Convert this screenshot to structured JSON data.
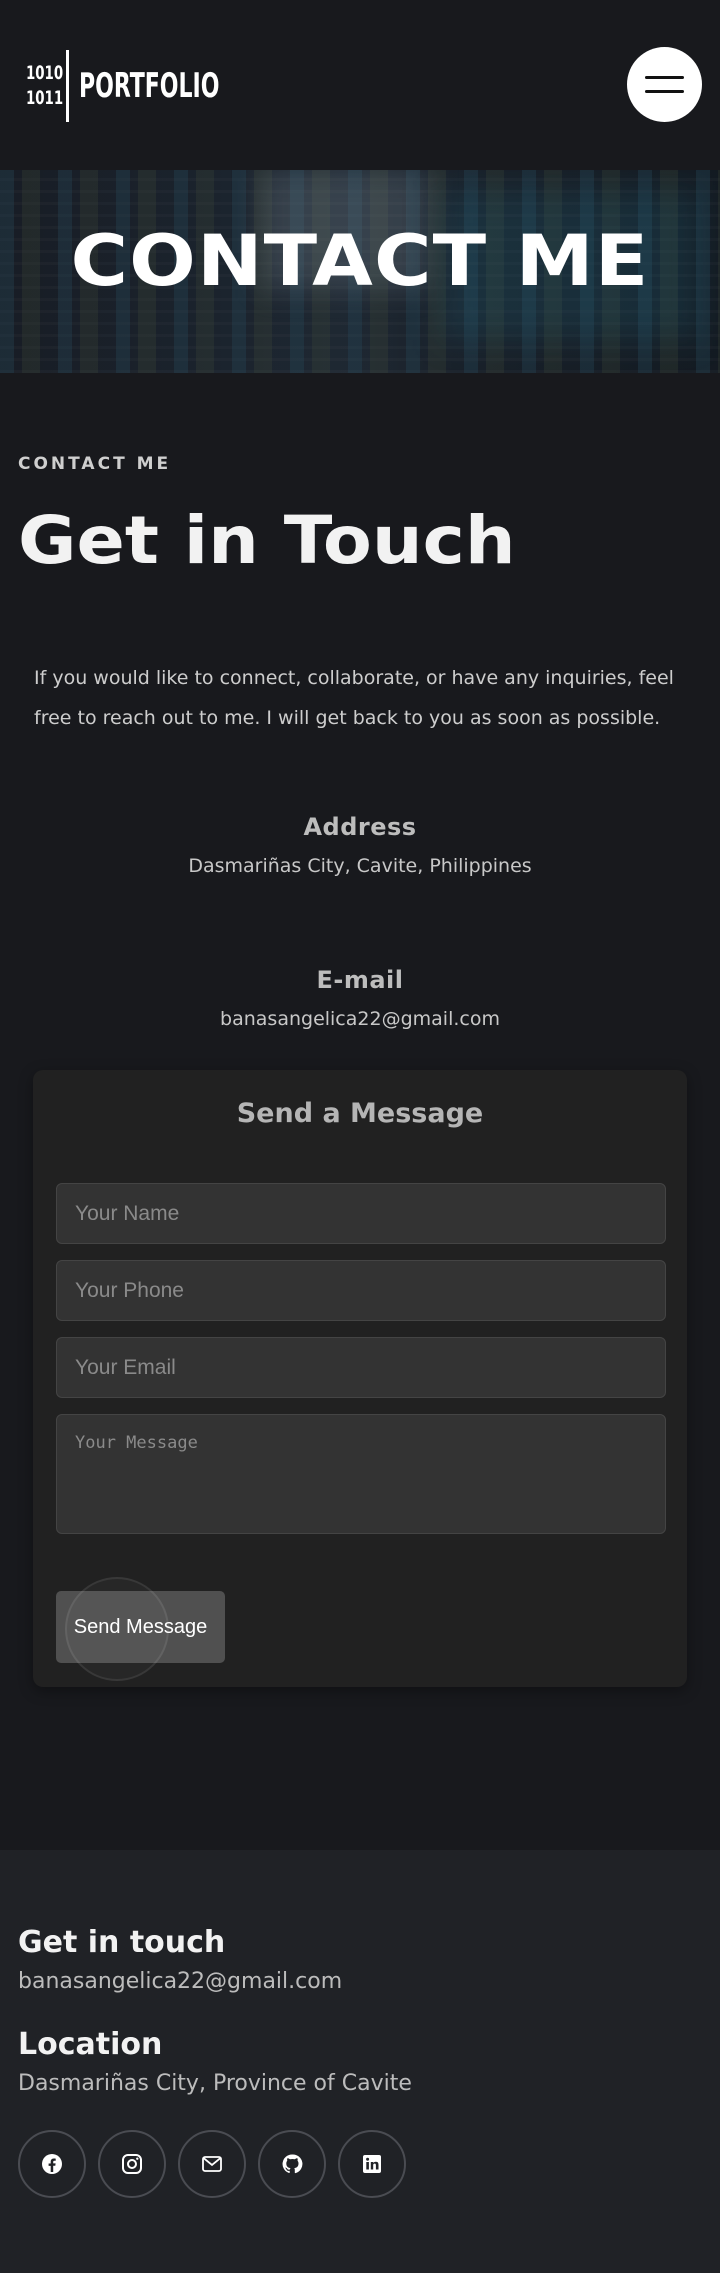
{
  "header": {
    "logo_binary_line1": "1010",
    "logo_binary_line2": "1011",
    "logo_text": "PORTFOLIO",
    "menu_icon": "hamburger-icon"
  },
  "hero": {
    "title": "CONTACT ME"
  },
  "section": {
    "eyebrow": "CONTACT ME",
    "headline": "Get in Touch",
    "intro": "If you would like to connect, collaborate, or have any inquiries, feel free to reach out to me. I will get back to you as soon as possible."
  },
  "address": {
    "title": "Address",
    "value": "Dasmariñas City, Cavite, Philippines"
  },
  "email": {
    "title": "E-mail",
    "value": "banasangelica22@gmail.com"
  },
  "form": {
    "title": "Send a Message",
    "name_placeholder": "Your Name",
    "phone_placeholder": "Your Phone",
    "email_placeholder": "Your Email",
    "message_placeholder": "Your Message",
    "submit_label": "Send Message"
  },
  "footer": {
    "get_in_touch_title": "Get in touch",
    "get_in_touch_value": "banasangelica22@gmail.com",
    "location_title": "Location",
    "location_value": "Dasmariñas City, Province of Cavite",
    "socials": [
      "facebook-icon",
      "instagram-icon",
      "mail-icon",
      "github-icon",
      "linkedin-icon"
    ]
  },
  "colors": {
    "page_background": "#18191d",
    "card_background": "#212121",
    "footer_background": "#202226",
    "button_background": "#505050"
  }
}
